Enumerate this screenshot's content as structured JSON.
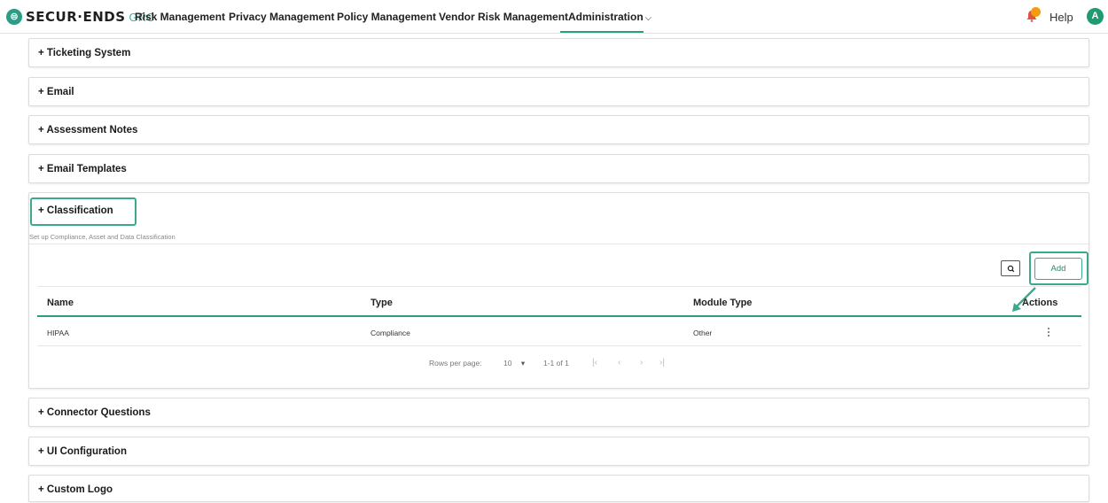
{
  "nav": {
    "logo_text": "SECUR·ENDS",
    "logo_suffix": "GRC",
    "items": [
      "Risk Management",
      "Privacy Management",
      "Policy Management",
      "Vendor Risk Management",
      "Administration"
    ],
    "help": "Help",
    "avatar_initial": "A",
    "notification_count": "0"
  },
  "panels": {
    "ticketing": "+ Ticketing System",
    "email": "+ Email",
    "assessment_notes": "+ Assessment Notes",
    "email_templates": "+ Email Templates",
    "classification": "+ Classification",
    "connector_questions": "+ Connector Questions",
    "ui_configuration": "+ UI Configuration",
    "custom_logo": "+ Custom Logo"
  },
  "classification": {
    "subtitle": "Set up Compliance, Asset and Data Classification",
    "add_label": "Add",
    "columns": [
      "Name",
      "Type",
      "Module Type",
      "Actions"
    ],
    "rows": [
      {
        "name": "HIPAA",
        "type": "Compliance",
        "module_type": "Other"
      }
    ],
    "pagination": {
      "rows_per_page_label": "Rows per page:",
      "rows_per_page_value": "10",
      "range": "1-1 of 1"
    }
  },
  "colors": {
    "accent": "#2a9d84",
    "highlight": "#3aa98c"
  }
}
